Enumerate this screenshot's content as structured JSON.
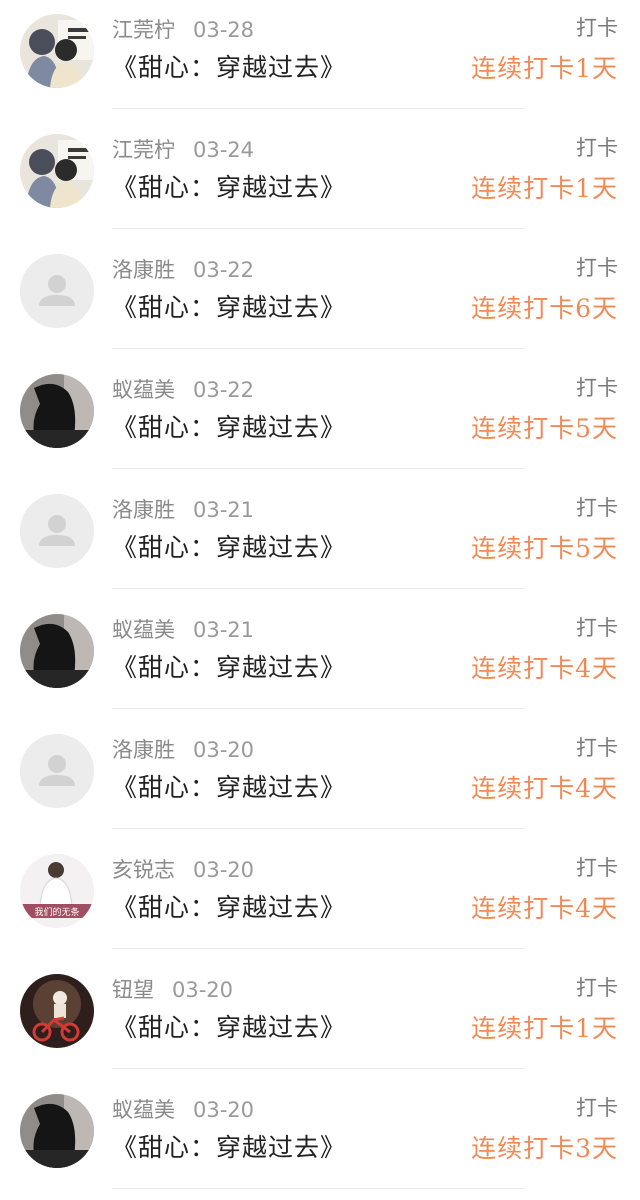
{
  "checkins": [
    {
      "name": "江莞柠",
      "date": "03-28",
      "book": "《甜心：穿越过去》",
      "action": "打卡",
      "streak": "连续打卡1天",
      "avatar_icon": "girls-photo-avatar-icon"
    },
    {
      "name": "江莞柠",
      "date": "03-24",
      "book": "《甜心：穿越过去》",
      "action": "打卡",
      "streak": "连续打卡1天",
      "avatar_icon": "girls-photo-avatar-icon"
    },
    {
      "name": "洛康胜",
      "date": "03-22",
      "book": "《甜心：穿越过去》",
      "action": "打卡",
      "streak": "连续打卡6天",
      "avatar_icon": "default-user-avatar-icon"
    },
    {
      "name": "蚁蕴美",
      "date": "03-22",
      "book": "《甜心：穿越过去》",
      "action": "打卡",
      "streak": "连续打卡5天",
      "avatar_icon": "dark-hair-avatar-icon"
    },
    {
      "name": "洛康胜",
      "date": "03-21",
      "book": "《甜心：穿越过去》",
      "action": "打卡",
      "streak": "连续打卡5天",
      "avatar_icon": "default-user-avatar-icon"
    },
    {
      "name": "蚁蕴美",
      "date": "03-21",
      "book": "《甜心：穿越过去》",
      "action": "打卡",
      "streak": "连续打卡4天",
      "avatar_icon": "dark-hair-avatar-icon"
    },
    {
      "name": "洛康胜",
      "date": "03-20",
      "book": "《甜心：穿越过去》",
      "action": "打卡",
      "streak": "连续打卡4天",
      "avatar_icon": "default-user-avatar-icon"
    },
    {
      "name": "亥锐志",
      "date": "03-20",
      "book": "《甜心：穿越过去》",
      "action": "打卡",
      "streak": "连续打卡4天",
      "avatar_icon": "woman-photo-avatar-icon",
      "avatar_text": "我们的无条"
    },
    {
      "name": "钮望",
      "date": "03-20",
      "book": "《甜心：穿越过去》",
      "action": "打卡",
      "streak": "连续打卡1天",
      "avatar_icon": "bicycle-photo-avatar-icon"
    },
    {
      "name": "蚁蕴美",
      "date": "03-20",
      "book": "《甜心：穿越过去》",
      "action": "打卡",
      "streak": "连续打卡3天",
      "avatar_icon": "dark-hair-avatar-icon"
    }
  ],
  "colors": {
    "name": "#8a8a8a",
    "date": "#9a9a9a",
    "title": "#222222",
    "action": "#7a7a7a",
    "streak": "#ef8a55",
    "divider": "#ececec"
  }
}
